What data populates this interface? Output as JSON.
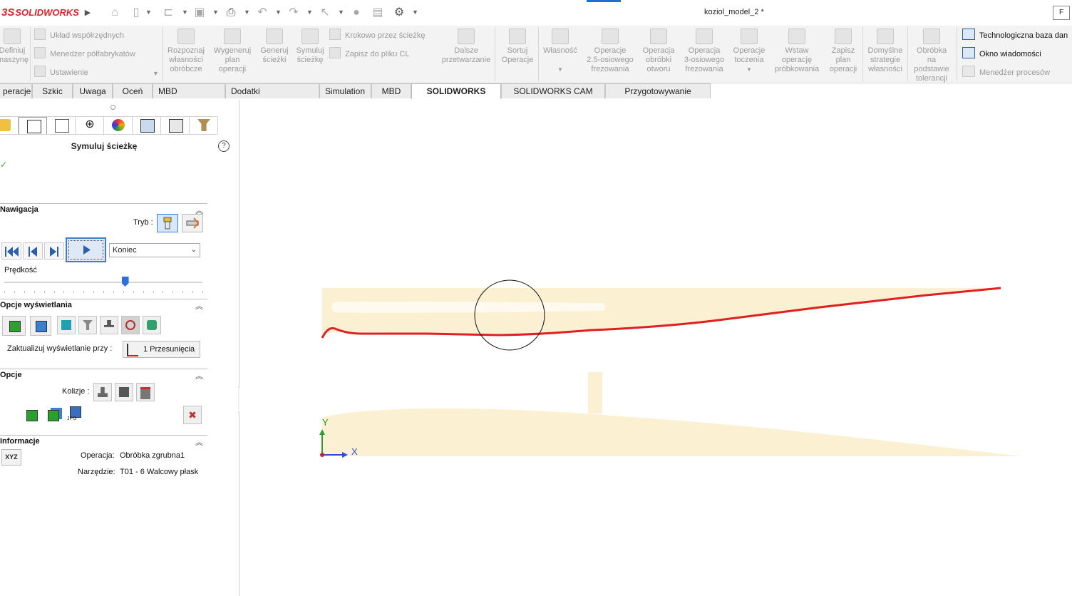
{
  "app": {
    "brand_prefix": "3S",
    "brand_solid": "SOLID",
    "brand_works": "WORKS"
  },
  "document": {
    "title": "koziol_model_2 *"
  },
  "cmd_button": "F",
  "ribbon": {
    "define_machine": [
      "Definiuj",
      "maszynę"
    ],
    "coord_system": "Układ współrzędnych",
    "stock_manager": "Menedżer półfabrykatów",
    "setup": "Ustawienie",
    "extract_features": [
      "Rozpoznaj",
      "własności",
      "obróbcze"
    ],
    "generate_plan": [
      "Wygeneruj",
      "plan",
      "operacji"
    ],
    "generate_toolpath": [
      "Generuj",
      "ścieżki"
    ],
    "simulate_toolpath": [
      "Symuluj",
      "ścieżkę"
    ],
    "step_through": "Krokowo przez ścieżkę",
    "save_cl": "Zapisz do pliku CL",
    "post_process": [
      "Dalsze",
      "przetwarzanie"
    ],
    "sort_ops": [
      "Sortuj",
      "Operacje"
    ],
    "feature": "Własność",
    "mill_25": [
      "Operacje",
      "2.5-osiowego",
      "frezowania"
    ],
    "hole_machining": [
      "Operacja",
      "obróbki",
      "otworu"
    ],
    "mill_3": [
      "Operacja",
      "3-osiowego",
      "frezowania"
    ],
    "turn_ops": [
      "Operacje",
      "toczenia"
    ],
    "probe_op": [
      "Wstaw",
      "operację",
      "próbkowania"
    ],
    "save_plan": [
      "Zapisz",
      "plan",
      "operacji"
    ],
    "default_strategy": [
      "Domyślne",
      "strategie",
      "własności"
    ],
    "tolerance_machining": [
      "Obróbka",
      "na",
      "podstawie",
      "tolerancji"
    ],
    "tech_db": "Technologiczna baza dan",
    "message_window": "Okno wiadomości",
    "process_manager": "Menedżer procesów"
  },
  "tabs": [
    "peracje",
    "Szkic",
    "Uwaga",
    "Oceń",
    "MBD Dimension",
    "Dodatki SOLIDWORKS",
    "Simulation",
    "MBD",
    "SOLIDWORKS CAM",
    "SOLIDWORKS CAM TBM",
    "Przygotowywanie analizy"
  ],
  "active_tab": "SOLIDWORKS CAM",
  "panel": {
    "title": "Symuluj ścieżkę",
    "help": "?",
    "ok": "✓",
    "navigation": {
      "header": "Nawigacja",
      "mode_label": "Tryb :",
      "end_option": "Koniec",
      "speed_label": "Prędkość",
      "speed_value": 0.61
    },
    "display": {
      "header": "Opcje wyświetlania",
      "update_label": "Zaktualizuj wyświetlanie przy :",
      "update_value": "1 Przesunięcia"
    },
    "options": {
      "header": "Opcje",
      "collision_label": "Kolizje :",
      "jpg": "JPG"
    },
    "info": {
      "header": "Informacje",
      "xyz": "XYZ",
      "operation_label": "Operacja:",
      "operation_value": "Obróbka zgrubna1",
      "tool_label": "Narzędzie:",
      "tool_value": "T01 - 6 Walcowy płask"
    }
  },
  "viewport": {
    "axis_x": "X",
    "axis_y": "Y"
  },
  "colors": {
    "toolpath": "#e02020",
    "stock": "#fbf1d2",
    "accent": "#1d6fd1",
    "brand": "#d8262b"
  }
}
